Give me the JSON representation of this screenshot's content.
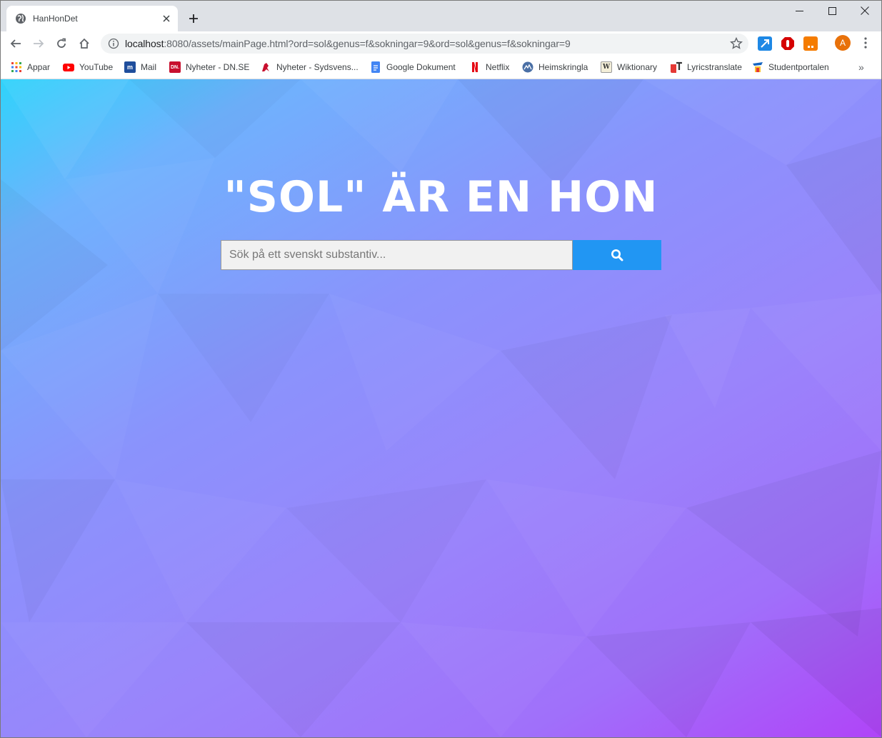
{
  "browser": {
    "tab": {
      "title": "HanHonDet",
      "favicon": "globe-icon"
    },
    "window_controls": [
      "minimize-icon",
      "maximize-icon",
      "close-icon"
    ],
    "url": {
      "host": "localhost",
      "path": ":8080/assets/mainPage.html?ord=sol&genus=f&sokningar=9&ord=sol&genus=f&sokningar=9"
    },
    "profile_initial": "A",
    "bookmarks": [
      {
        "label": "Appar",
        "icon": "apps-grid-icon",
        "color": "#4285f4"
      },
      {
        "label": "YouTube",
        "icon": "youtube-icon",
        "color": "#ff0000"
      },
      {
        "label": "Mail",
        "icon": "mail-icon",
        "color": "#1f4e9c"
      },
      {
        "label": "Nyheter - DN.SE",
        "icon": "dn-icon",
        "color": "#c8102e"
      },
      {
        "label": "Nyheter - Sydsvens...",
        "icon": "sydsvenskan-icon",
        "color": "#c8102e"
      },
      {
        "label": "Google Dokument",
        "icon": "google-docs-icon",
        "color": "#4285f4"
      },
      {
        "label": "Netflix",
        "icon": "netflix-icon",
        "color": "#e50914"
      },
      {
        "label": "Heimskringla",
        "icon": "heimskringla-icon",
        "color": "#4a6fa5"
      },
      {
        "label": "Wiktionary",
        "icon": "wiktionary-icon",
        "color": "#333333"
      },
      {
        "label": "Lyricstranslate",
        "icon": "lyricstranslate-icon",
        "color": "#e53935"
      },
      {
        "label": "Studentportalen",
        "icon": "studentportalen-icon",
        "color": "#1565c0"
      }
    ],
    "bookmarks_more": "»"
  },
  "page": {
    "headline": "\"SOL\" ÄR EN HON",
    "search": {
      "placeholder": "Sök på ett svenskt substantiv...",
      "value": "",
      "button_icon": "search-icon"
    },
    "colors": {
      "button": "#2196f3",
      "gradient_start": "#2fd3fb",
      "gradient_end": "#b044f8"
    }
  }
}
